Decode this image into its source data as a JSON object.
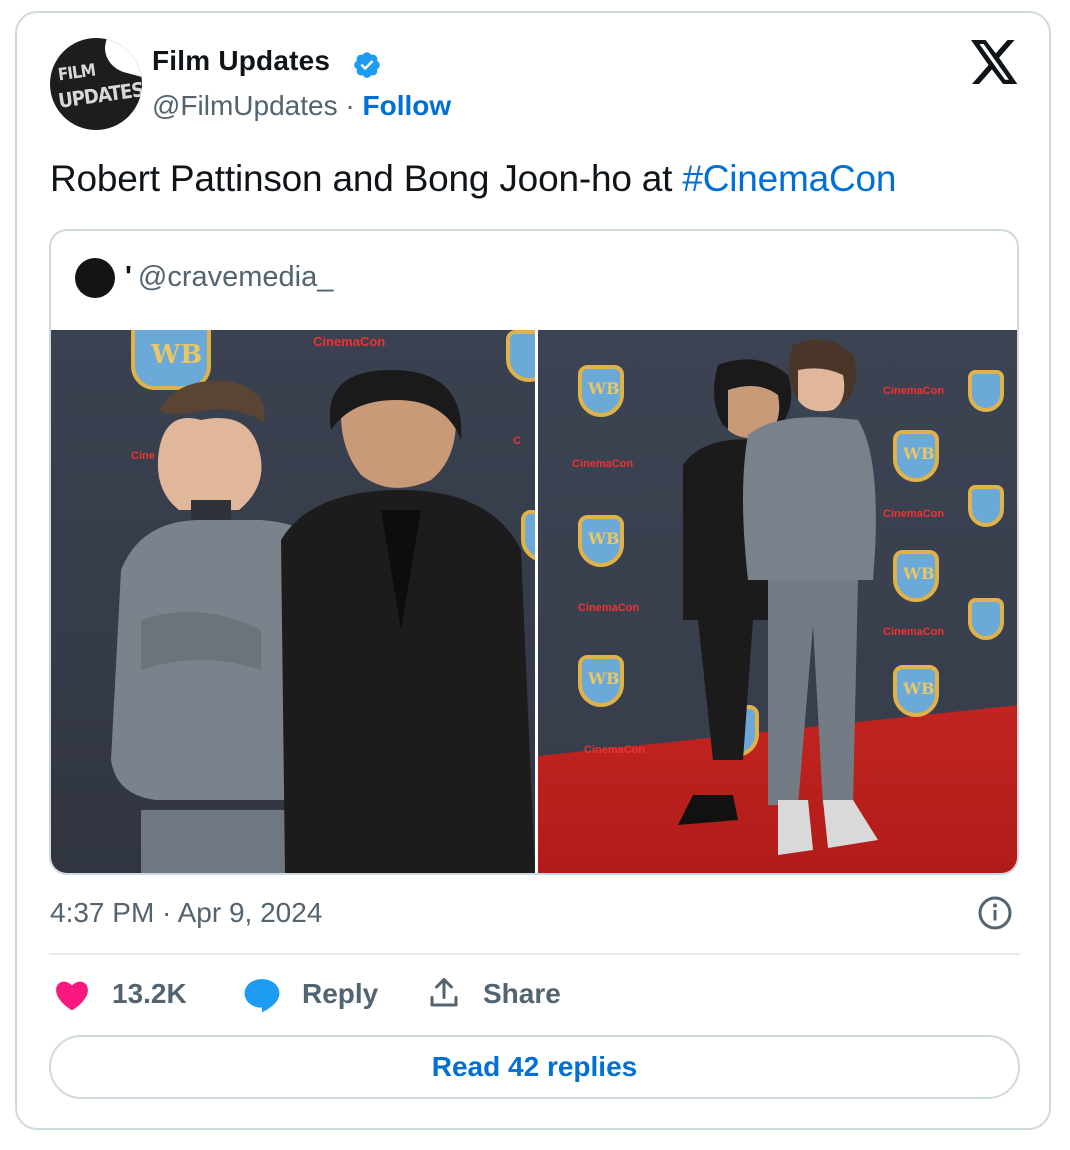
{
  "author": {
    "avatar_text_line1": "FILM",
    "avatar_text_line2": "UPDATES",
    "name": "Film Updates",
    "handle": "@FilmUpdates",
    "separator": "·",
    "follow_label": "Follow"
  },
  "tweet": {
    "text": "Robert Pattinson and Bong Joon-ho at ",
    "hashtag": "#CinemaCon"
  },
  "quote": {
    "handle_prefix": "'",
    "handle": "@cravemedia_"
  },
  "timestamp": "4:37 PM · Apr 9, 2024",
  "actions": {
    "likes": "13.2K",
    "reply_label": "Reply",
    "share_label": "Share"
  },
  "read_replies_label": "Read 42 replies",
  "icons": {
    "verified": "verified-badge-icon",
    "x_logo": "x-logo-icon",
    "info": "info-icon",
    "like": "heart-icon",
    "reply": "speech-bubble-icon",
    "share": "share-upload-icon"
  },
  "colors": {
    "link": "#006fd6",
    "secondary_text": "#536471",
    "heart": "#f91880",
    "reply_icon": "#1d9bf0",
    "border": "#cfd9de"
  }
}
